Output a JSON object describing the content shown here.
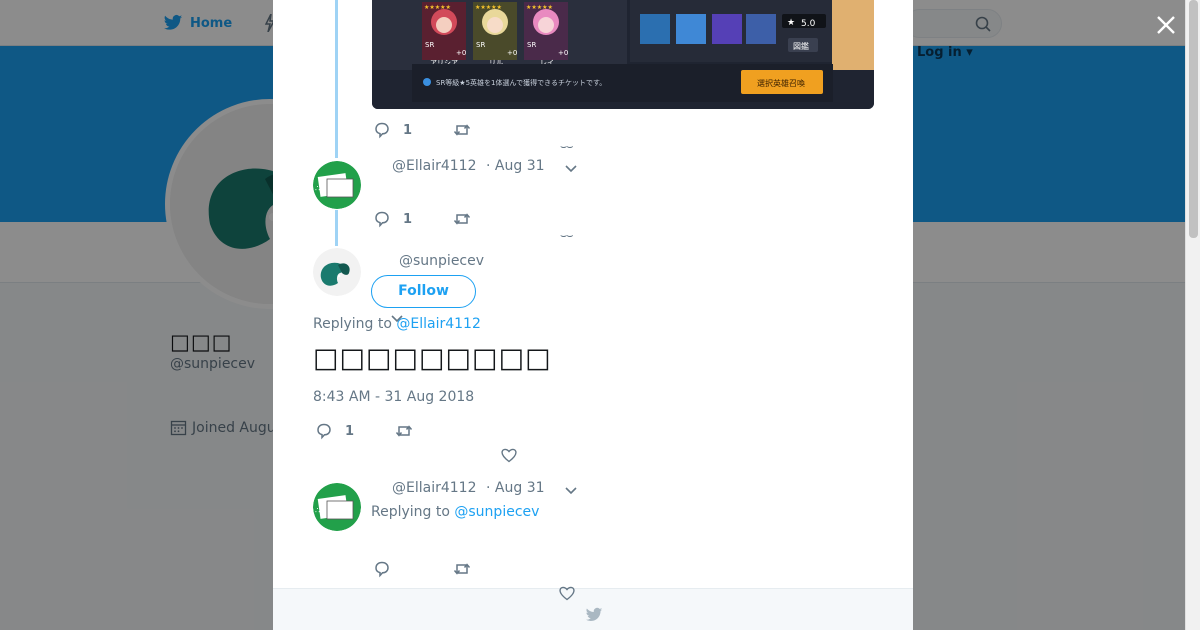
{
  "background": {
    "nav": {
      "home_label": "Home",
      "login_text": "Log in ▾"
    },
    "profile": {
      "name": "□□□",
      "handle": "@sunpiecev",
      "joined": "Joined Augu"
    },
    "colors": {
      "header_blue": "#1da1f2",
      "nav_bg": "#ffffff"
    }
  },
  "media": {
    "hero_labels": [
      "アリシア",
      "リル",
      "レイ"
    ],
    "rating": "5.0",
    "zukan_label": "図鑑",
    "notice": "SR等級★5英雄を1体選んで獲得できるチケットです。",
    "summon_button": "選択英雄召喚"
  },
  "thread": {
    "tweet1_actions": {
      "reply_count": "1"
    },
    "tweet2": {
      "handle": "@Ellair4112",
      "date": "· Aug 31",
      "reply_count": "1"
    },
    "main_tweet": {
      "handle": "@sunpiecev",
      "follow_label": "Follow",
      "replying_prefix": "Replying to",
      "replying_to": "@Ellair4112",
      "text": "□□□□□□□□□",
      "timestamp": "8:43 AM - 31 Aug 2018",
      "reply_count": "1"
    },
    "tweet4": {
      "handle": "@Ellair4112",
      "date": "· Aug 31",
      "replying_prefix": "Replying to",
      "replying_to": "@sunpiecev"
    }
  },
  "icons": {
    "close": "close-icon",
    "reply": "reply-icon",
    "retweet": "retweet-icon",
    "like": "heart-icon",
    "bird": "twitter-bird-icon"
  }
}
